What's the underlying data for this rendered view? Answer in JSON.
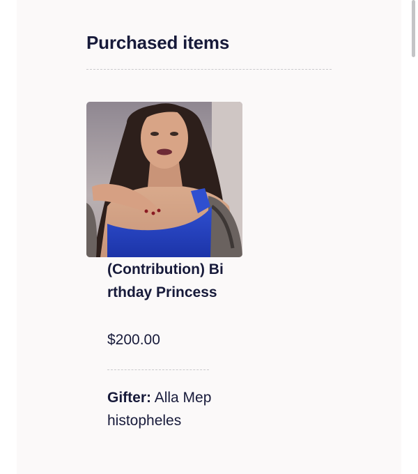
{
  "section": {
    "title": "Purchased items"
  },
  "item": {
    "photo_alt": "Item photo",
    "title": "(Contribution) Birthday Princess",
    "price": "$200.00",
    "gifter_label": "Gifter:",
    "gifter_name": "Alla Mephistopheles"
  },
  "colors": {
    "background": "#ffffff",
    "card": "#fbf9f9",
    "text": "#171a3a",
    "divider": "#c9c9cc"
  }
}
